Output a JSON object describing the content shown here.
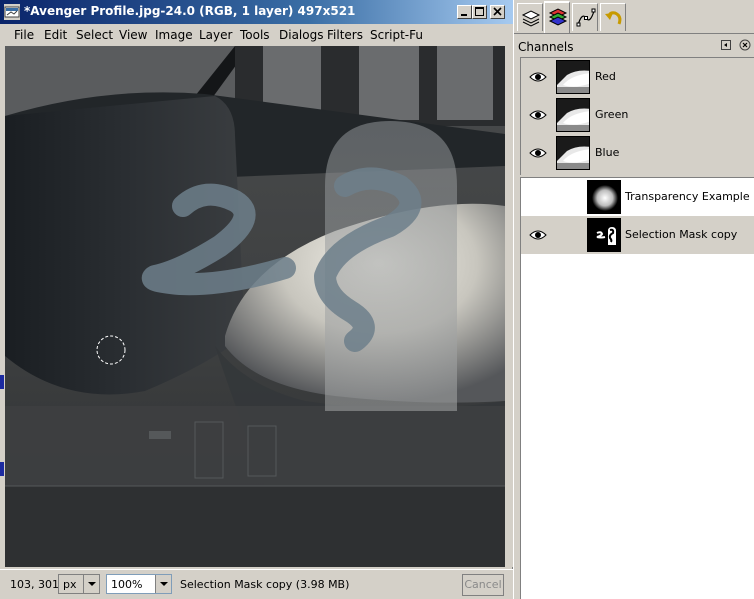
{
  "window": {
    "title": "*Avenger Profile.jpg-24.0 (RGB, 1 layer) 497x521"
  },
  "menu": [
    "File",
    "Edit",
    "Select",
    "View",
    "Image",
    "Layer",
    "Tools",
    "Dialogs",
    "Filters",
    "Script-Fu"
  ],
  "status": {
    "coords": "103, 301",
    "unit": "px",
    "zoom": "100%",
    "message": "Selection Mask copy (3.98 MB)",
    "cancel_label": "Cancel"
  },
  "dock": {
    "title": "Channels",
    "tabs": [
      "layers-icon",
      "channels-icon",
      "paths-icon",
      "undo-history-icon"
    ],
    "channels": [
      {
        "label": "Red",
        "visible": true
      },
      {
        "label": "Green",
        "visible": true
      },
      {
        "label": "Blue",
        "visible": true
      }
    ],
    "masks": [
      {
        "label": "Transparency Example",
        "visible": false
      },
      {
        "label": "Selection Mask copy",
        "visible": true
      }
    ]
  },
  "colors": {
    "titlebar_start": "#0a246a",
    "titlebar_end": "#a6caf0",
    "dock_bg": "#d4d0c8",
    "selected_row": "#d4d0c8"
  }
}
